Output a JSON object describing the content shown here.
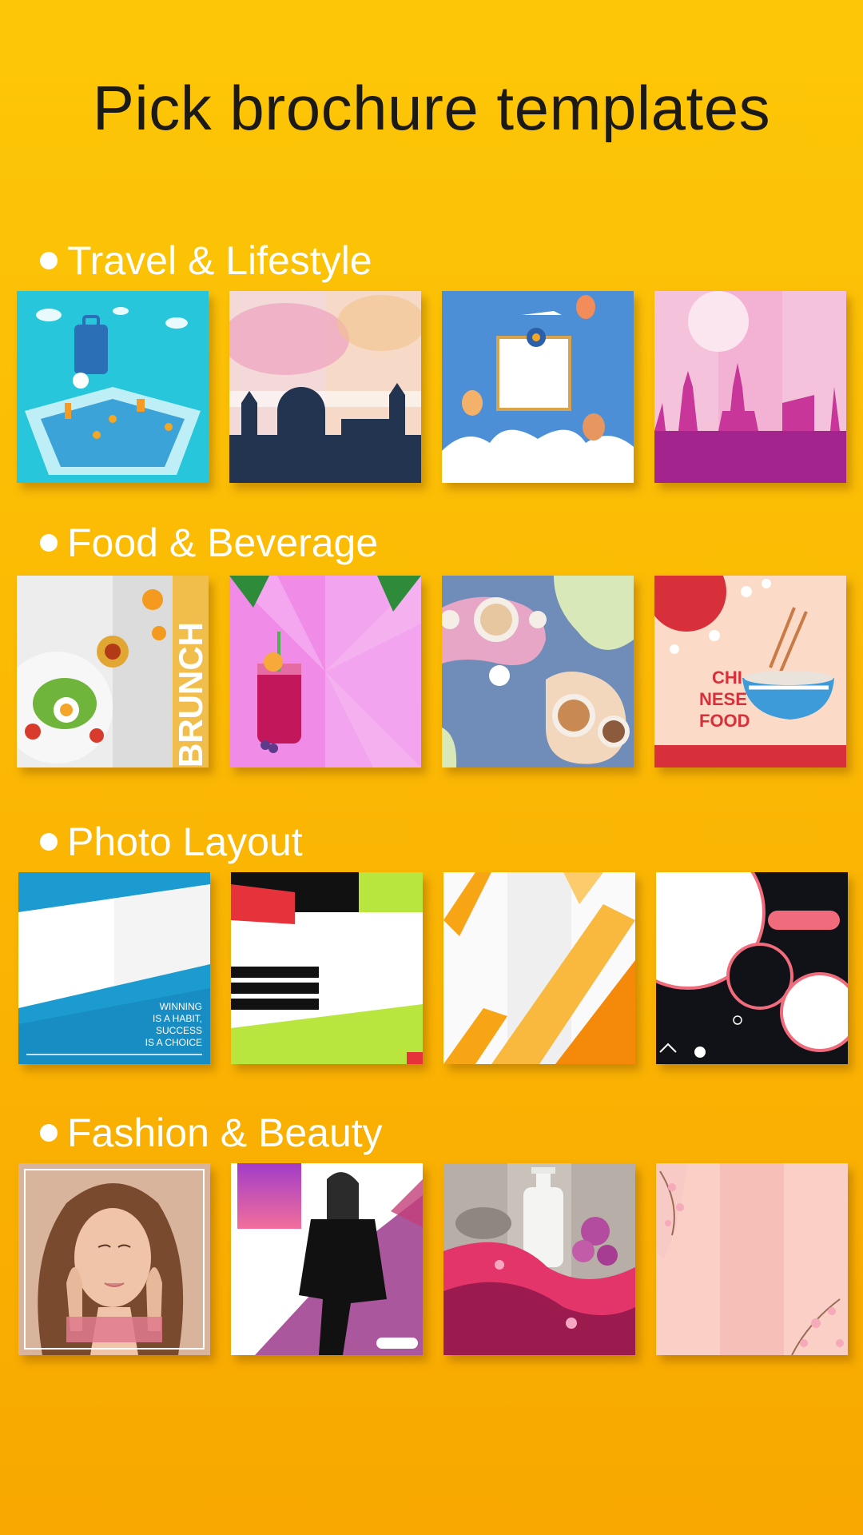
{
  "title": "Pick brochure templates",
  "sections": [
    {
      "title": "Travel & Lifestyle",
      "templates": [
        {
          "name": "travel-map"
        },
        {
          "name": "travel-city-watercolor"
        },
        {
          "name": "travel-balloon-frame"
        },
        {
          "name": "travel-landmarks-pink"
        }
      ]
    },
    {
      "title": "Food & Beverage",
      "templates": [
        {
          "name": "food-brunch",
          "text": "BRUNCH"
        },
        {
          "name": "food-smoothie"
        },
        {
          "name": "food-ramen-bowls"
        },
        {
          "name": "food-chinese",
          "text_lines": [
            "CHI",
            "NESE",
            "FOOD"
          ]
        }
      ]
    },
    {
      "title": "Photo Layout",
      "templates": [
        {
          "name": "photo-blue-wave",
          "text_lines": [
            "WINNING",
            "IS A HABIT,",
            "SUCCESS",
            "IS A CHOICE"
          ]
        },
        {
          "name": "photo-red-lime-stripes"
        },
        {
          "name": "photo-orange-diagonal"
        },
        {
          "name": "photo-dark-circles"
        }
      ]
    },
    {
      "title": "Fashion & Beauty",
      "templates": [
        {
          "name": "beauty-portrait"
        },
        {
          "name": "fashion-model-purple"
        },
        {
          "name": "beauty-lotion-bottle"
        },
        {
          "name": "beauty-pink-blossom"
        }
      ]
    }
  ],
  "colors": {
    "background_top": "#FDC707",
    "background_bottom": "#F8A800",
    "title": "#1b1a17",
    "section_title": "#ffffff"
  }
}
